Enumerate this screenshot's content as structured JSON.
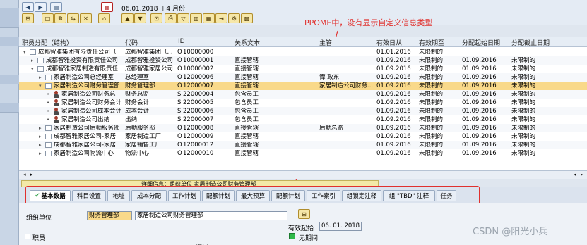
{
  "toolbar": {
    "date_text": "06.01.2018 ＋4 月份"
  },
  "annotation": "PPOME中，没有显示自定义信息类型",
  "tree": {
    "columns": [
      "职员分配（结构）",
      "代码",
      "ID",
      "关系文本",
      "主管",
      "有效日从",
      "有效期至",
      "分配起始日期",
      "分配截止日期"
    ],
    "rows": [
      {
        "name": "成都智雅集团有限责任公司（",
        "code": "成都智雅集团（...",
        "type": "O",
        "id": "10000000",
        "rel": "",
        "mgr": "",
        "from": "01.01.2016",
        "to": "未限制的",
        "af": "",
        "at": "",
        "level": 0,
        "icon": "box",
        "exp": "▾"
      },
      {
        "name": "成都智雅投资有限责任公司",
        "code": "成都智雅投资公司",
        "type": "O",
        "id": "10000001",
        "rel": "直接管辖",
        "mgr": "",
        "from": "01.09.2016",
        "to": "未限制的",
        "af": "01.09.2016",
        "at": "未限制的",
        "level": 1,
        "icon": "box",
        "exp": "▸"
      },
      {
        "name": "成都智雅家居制造有限责任",
        "code": "成都智雅家居公司",
        "type": "O",
        "id": "10000002",
        "rel": "直接管辖",
        "mgr": "",
        "from": "01.09.2016",
        "to": "未限制的",
        "af": "01.09.2016",
        "at": "未限制的",
        "level": 1,
        "icon": "box",
        "exp": "▾"
      },
      {
        "name": "家居制造公司总经理室",
        "code": "总经理室",
        "type": "O",
        "id": "12000006",
        "rel": "直接管辖",
        "mgr": "谭 政东",
        "from": "01.09.2016",
        "to": "未限制的",
        "af": "01.09.2016",
        "at": "未限制的",
        "level": 2,
        "icon": "box",
        "exp": "▸"
      },
      {
        "name": "家居制造公司财务管理部",
        "code": "财务管理部",
        "type": "O",
        "id": "12000007",
        "rel": "直接管辖",
        "mgr": "家居制造公司财务...",
        "from": "01.09.2016",
        "to": "未限制的",
        "af": "01.09.2016",
        "at": "未限制的",
        "level": 2,
        "icon": "box",
        "exp": "▾",
        "selected": true
      },
      {
        "name": "家居制造公司财务总",
        "code": "财务总监",
        "type": "S",
        "id": "22000004",
        "rel": "包含员工",
        "mgr": "",
        "from": "01.09.2016",
        "to": "未限制的",
        "af": "01.09.2016",
        "at": "未限制的",
        "level": 3,
        "icon": "person",
        "exp": "•"
      },
      {
        "name": "家居制造公司财务会计",
        "code": "财务会计",
        "type": "S",
        "id": "22000005",
        "rel": "包含员工",
        "mgr": "",
        "from": "01.09.2016",
        "to": "未限制的",
        "af": "01.09.2016",
        "at": "未限制的",
        "level": 3,
        "icon": "person",
        "exp": "•"
      },
      {
        "name": "家居制造公司成本会计",
        "code": "成本会计",
        "type": "S",
        "id": "22000006",
        "rel": "包含员工",
        "mgr": "",
        "from": "01.09.2016",
        "to": "未限制的",
        "af": "01.09.2016",
        "at": "未限制的",
        "level": 3,
        "icon": "person",
        "exp": "•"
      },
      {
        "name": "家居制造公司出纳",
        "code": "出纳",
        "type": "S",
        "id": "22000007",
        "rel": "包含员工",
        "mgr": "",
        "from": "01.09.2016",
        "to": "未限制的",
        "af": "01.09.2016",
        "at": "未限制的",
        "level": 3,
        "icon": "person",
        "exp": "•"
      },
      {
        "name": "家居制造公司后勤服务部",
        "code": "后勤服务部",
        "type": "O",
        "id": "12000008",
        "rel": "直接管辖",
        "mgr": "后勤总监",
        "from": "01.09.2016",
        "to": "未限制的",
        "af": "01.09.2016",
        "at": "未限制的",
        "level": 2,
        "icon": "box",
        "exp": "▸"
      },
      {
        "name": "成都智雅家居公司-家居",
        "code": "家居制造工厂",
        "type": "O",
        "id": "12000009",
        "rel": "直接管辖",
        "mgr": "",
        "from": "01.09.2016",
        "to": "未限制的",
        "af": "01.09.2016",
        "at": "未限制的",
        "level": 2,
        "icon": "box",
        "exp": "▸"
      },
      {
        "name": "成都智雅家居公司-家居",
        "code": "家居销售工厂",
        "type": "O",
        "id": "12000012",
        "rel": "直接管辖",
        "mgr": "",
        "from": "01.09.2016",
        "to": "未限制的",
        "af": "01.09.2016",
        "at": "未限制的",
        "level": 2,
        "icon": "box",
        "exp": "▸"
      },
      {
        "name": "家居制造公司物流中心",
        "code": "物流中心",
        "type": "O",
        "id": "12000010",
        "rel": "直接管辖",
        "mgr": "",
        "from": "01.09.2016",
        "to": "未限制的",
        "af": "01.09.2016",
        "at": "未限制的",
        "level": 2,
        "icon": "box",
        "exp": "▸"
      }
    ]
  },
  "detail_text": "详细信息：组织单位 家居制造公司财务管理部",
  "tabs": [
    "基本数据",
    "科目设置",
    "地址",
    "成本分配",
    "工作计划",
    "配额计划",
    "最大预算",
    "配额计划",
    "工作索引",
    "组锁定注释",
    "组 \"TBD\" 注释",
    "任务"
  ],
  "form": {
    "org_unit_label": "组织单位",
    "org_unit_code": "财务管理部",
    "org_unit_name": "家居制造公司财务管理部",
    "valid_from_label": "有效起始",
    "valid_from_value": "06. 01. 2018",
    "unlimited_label": "无期间",
    "staff_label": "职员",
    "desc_label": "描述"
  },
  "watermark": "CSDN @阳光小兵"
}
